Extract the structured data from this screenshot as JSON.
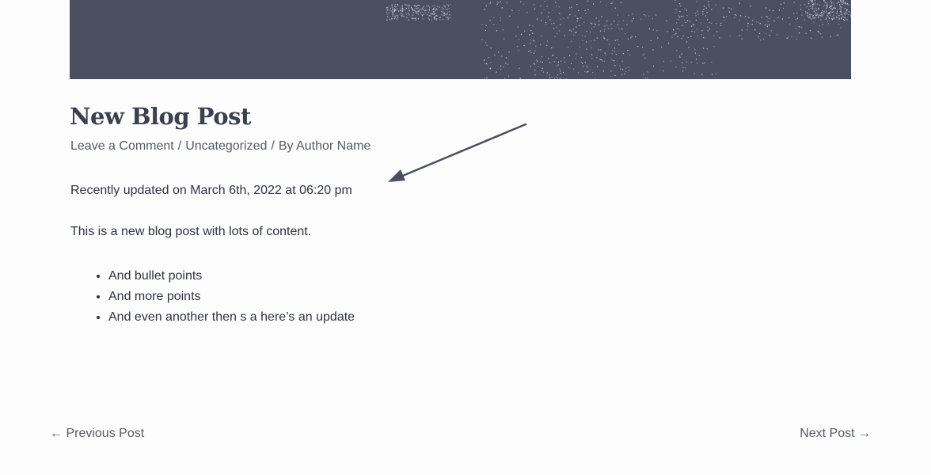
{
  "post": {
    "title": "New Blog Post",
    "meta": {
      "comment_link": "Leave a Comment",
      "separator": "/",
      "category": "Uncategorized",
      "author_prefix": "By",
      "author": "Author Name"
    },
    "updated_text": "Recently updated on March 6th, 2022 at 06:20 pm",
    "intro": "This is a new blog post with lots of content.",
    "bullets": [
      "And bullet points",
      "And more points",
      "And even another then s a here’s an update"
    ]
  },
  "navigation": {
    "previous": "← Previous Post",
    "next": "Next Post →"
  },
  "colors": {
    "hero_bg": "#4b5060",
    "heading": "#3b3f4e",
    "text": "#2f3340",
    "arrow": "#4a4e5e"
  },
  "icons": {
    "annotation": "arrow-annotation-icon"
  }
}
